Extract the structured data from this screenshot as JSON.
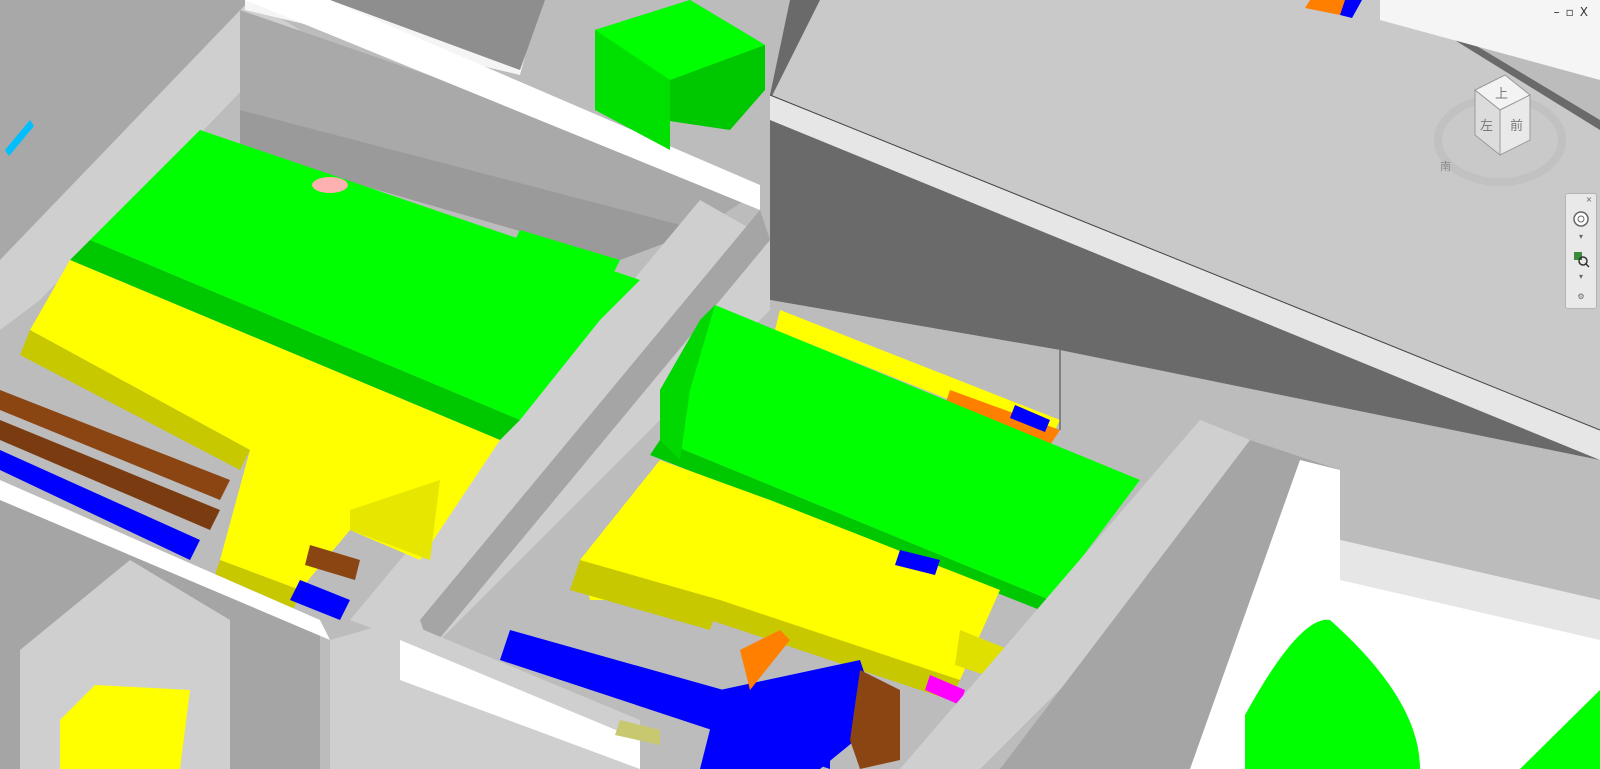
{
  "window": {
    "minimize_icon": "minimize-icon",
    "restore_icon": "restore-icon",
    "close_icon": "close-icon",
    "minimize_glyph": "–",
    "restore_glyph": "▫",
    "close_glyph": "X"
  },
  "viewcube": {
    "top_face": "上",
    "left_face": "左",
    "front_face": "前",
    "compass_south": "南"
  },
  "navigation_bar": {
    "steering_wheel_icon": "steering-wheel-icon",
    "zoom_icon": "zoom-icon",
    "close_glyph": "×",
    "customize_glyph": "⚙"
  },
  "colors": {
    "duct_green": "#00ff00",
    "duct_green_side": "#00c800",
    "tray_yellow": "#ffff00",
    "tray_yellow_side": "#c8c800",
    "pipe_blue": "#0000ff",
    "pipe_brown": "#8b4513",
    "pipe_orange": "#ff7f00",
    "pipe_magenta": "#ff00ff",
    "pipe_cyan": "#00bfff",
    "wall_light": "#cfcfcf",
    "wall_mid": "#a5a5a5",
    "wall_dark": "#666666",
    "slab_white": "#f4f4f4"
  }
}
